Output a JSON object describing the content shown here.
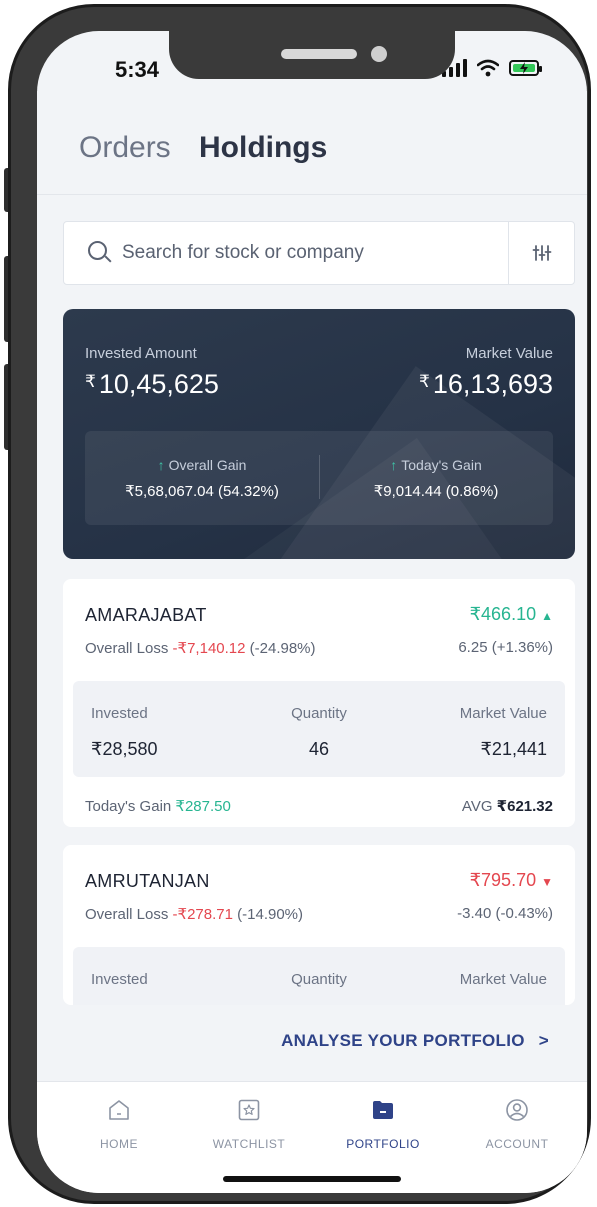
{
  "status_bar": {
    "time": "5:34"
  },
  "header": {
    "tabs": [
      {
        "label": "Orders"
      },
      {
        "label": "Holdings"
      }
    ]
  },
  "search": {
    "placeholder": "Search for stock or company"
  },
  "summary": {
    "invested_label": "Invested Amount",
    "invested_value": "10,45,625",
    "market_label": "Market Value",
    "market_value": "16,13,693",
    "currency": "₹",
    "overall_gain_label": "Overall Gain",
    "overall_gain_value": "₹5,68,067.04 (54.32%)",
    "today_gain_label": "Today's Gain",
    "today_gain_value": "₹9,014.44 (0.86%)"
  },
  "holdings": [
    {
      "name": "AMARAJABAT",
      "price": "₹466.10",
      "price_direction": "up",
      "overall_label": "Overall Loss",
      "overall_amount": "-₹7,140.12",
      "overall_pct": "(-24.98%)",
      "day_change": "6.25 (+1.36%)",
      "invested_label": "Invested",
      "invested": "₹28,580",
      "quantity_label": "Quantity",
      "quantity": "46",
      "market_label": "Market Value",
      "market_value": "₹21,441",
      "today_gain_label": "Today's Gain",
      "today_gain": "₹287.50",
      "avg_label": "AVG",
      "avg": "₹621.32"
    },
    {
      "name": "AMRUTANJAN",
      "price": "₹795.70",
      "price_direction": "down",
      "overall_label": "Overall Loss",
      "overall_amount": "-₹278.71",
      "overall_pct": "(-14.90%)",
      "day_change": "-3.40 (-0.43%)",
      "invested_label": "Invested",
      "quantity_label": "Quantity",
      "market_label": "Market Value"
    }
  ],
  "analyse": {
    "label": "ANALYSE YOUR PORTFOLIO"
  },
  "bottom_nav": {
    "items": [
      {
        "label": "HOME",
        "icon": "home-icon"
      },
      {
        "label": "WATCHLIST",
        "icon": "star-icon"
      },
      {
        "label": "PORTFOLIO",
        "icon": "folder-icon",
        "active": true
      },
      {
        "label": "ACCOUNT",
        "icon": "user-icon"
      }
    ]
  },
  "colors": {
    "accent": "#2f4388",
    "gain": "#27b591",
    "loss": "#e4474f",
    "card_dark": "#253246"
  }
}
